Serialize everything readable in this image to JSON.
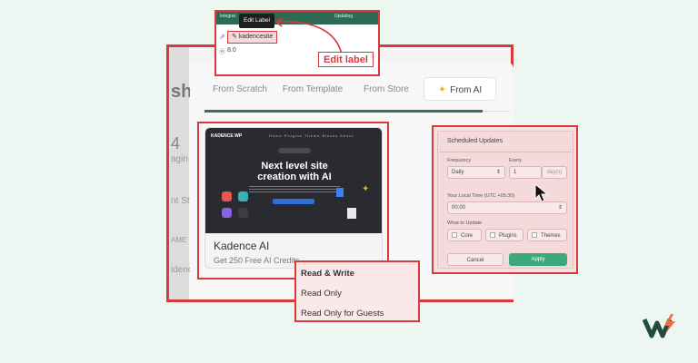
{
  "colors": {
    "highlight": "#d63a3a",
    "tab_indicator": "#3c6a5c",
    "apply": "#3ba97a",
    "background": "#eef6f1"
  },
  "background_fragments": [
    "shb",
    "4",
    "agin",
    "nt Sta",
    "AME",
    "idence"
  ],
  "tabs": [
    {
      "label": "From Scratch",
      "selected": false
    },
    {
      "label": "From Template",
      "selected": false
    },
    {
      "label": "From Store",
      "selected": false
    },
    {
      "label": "From AI",
      "selected": true,
      "icon": "sparkle-icon"
    }
  ],
  "card": {
    "preview": {
      "logo": "KADENCE WP",
      "nav": "Home  Plugins  Theme  Blocks  About",
      "headline_line1": "Next level site",
      "headline_line2": "creation with AI"
    },
    "title": "Kadence AI",
    "subtitle": "Get 250 Free AI Credits"
  },
  "access_options": [
    "Read & Write",
    "Read Only",
    "Read Only for Guests"
  ],
  "scheduled_updates": {
    "title": "Scheduled Updates",
    "frequency_label": "Frequency",
    "frequency_value": "Daily",
    "every_label": "Every",
    "every_value": "1",
    "every_unit": "day(s)",
    "time_label": "Your Local Time (UTC +05:30)",
    "time_value": "00:00",
    "what_label": "What to Update",
    "options": [
      "Core",
      "Plugins",
      "Themes"
    ],
    "cancel": "Cancel",
    "apply": "Apply"
  },
  "edit_zoom": {
    "tooltip": "Edit Label",
    "site_label": "kadencesite",
    "version": "8.0",
    "callout": "Edit label",
    "topbar_fragments": [
      "Integrat",
      "Updating"
    ]
  }
}
